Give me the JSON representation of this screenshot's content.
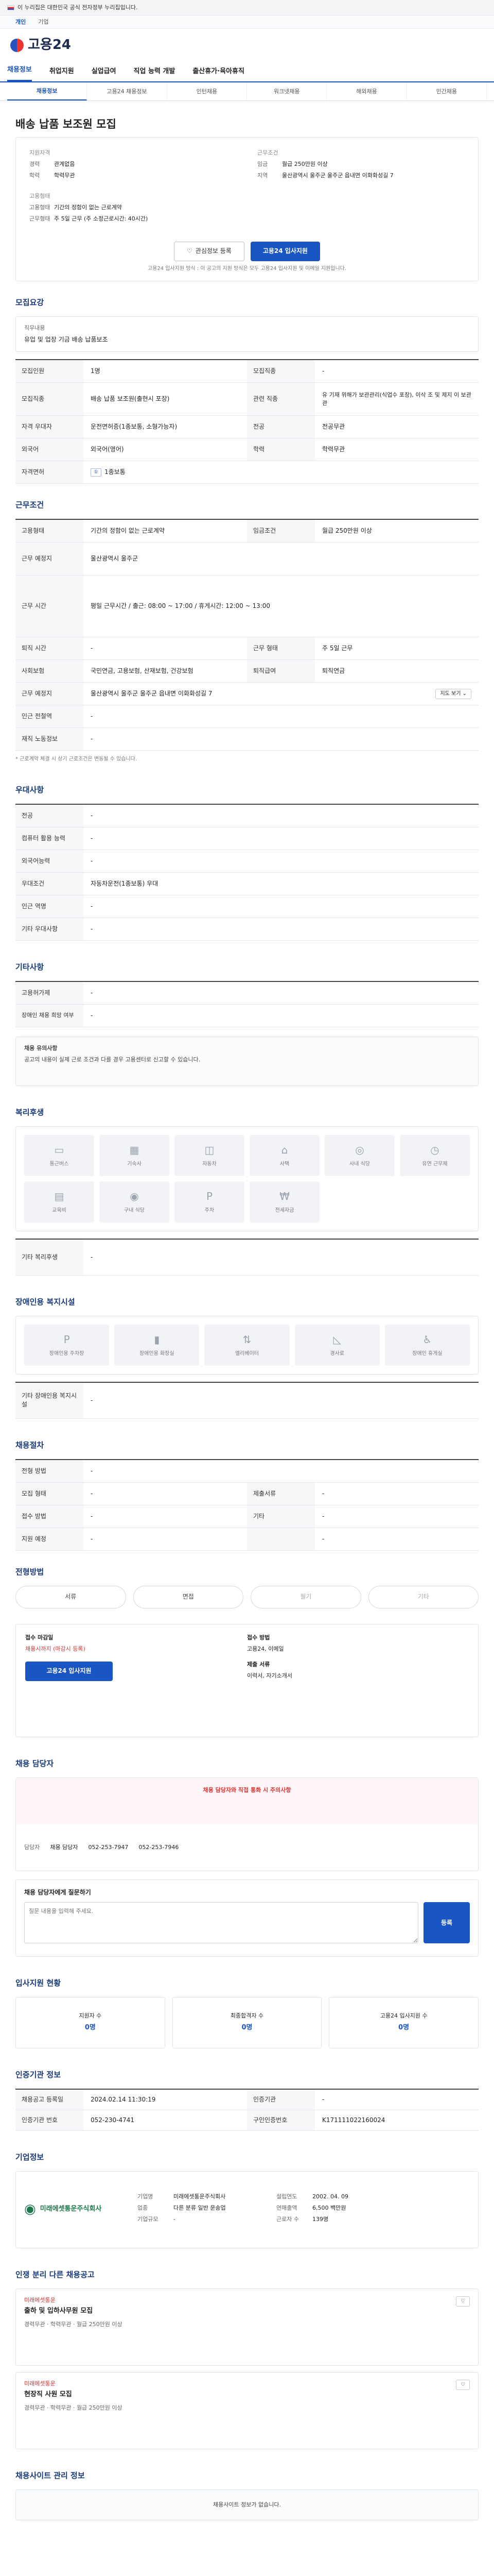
{
  "banner": {
    "text": "이 누리집은 대한민국 공식 전자정부 누리집입니다.",
    "link": ""
  },
  "lang": {
    "items": [
      "개인",
      "기업"
    ]
  },
  "logo": {
    "name": "고용24"
  },
  "gnb": {
    "items": [
      "채용정보",
      "취업지원",
      "실업급여",
      "직업 능력 개발",
      "출산휴가·육아휴직"
    ]
  },
  "subtabs": {
    "items": [
      "채용정보",
      "고용24 채용정보",
      "인턴채용",
      "워크넷채용",
      "해외채용",
      "민간채용"
    ]
  },
  "job": {
    "title": "배송 납품 보조원 모집",
    "summary": {
      "left_head": "지원자격",
      "left": [
        {
          "k": "경력",
          "v": "관계없음"
        },
        {
          "k": "학력",
          "v": "학력무관"
        }
      ],
      "left2_head": "고용형태",
      "left2": [
        {
          "k": "고용형태",
          "v": "기간의 정함이 없는 근로계약"
        },
        {
          "k": "근무형태",
          "v": "주 5일 근무 (주 소정근로시간: 40시간)"
        }
      ],
      "right_head": "근무조건",
      "right": [
        {
          "k": "임금",
          "v": "월급 250만원 이상"
        },
        {
          "k": "지역",
          "v": "울산광역시 울주군 울주군 읍내면 이화화성길 7"
        },
        {
          "k": "",
          "v": ""
        }
      ],
      "btn_save": "관심정보 등록",
      "btn_apply": "고용24 입사지원",
      "note": "고용24 입사지원 방식 : 이 공고의 지원 방식은 모두 고용24 입사지원 및 이메일 지원입니다."
    }
  },
  "sections": {
    "recruit": "모집요강",
    "recruit_job_head": "직무내용",
    "recruit_job": "유업 및 업장 기금 배송 납품보조",
    "recruit_rows": [
      {
        "k": "모집인원",
        "v": "1명",
        "k2": "모집직종",
        "v2": "-"
      },
      {
        "k": "모집직종",
        "v": "배송 납품 보조원(출현시 포장)",
        "k2": "관련 직종",
        "v2": "유 기재 위해가 보관관리(식업수 포장), 이삭 조 및 제지 이 보관관"
      },
      {
        "k": "자격 우대자",
        "v": "운전면허증(1종보통, 소형가능자)",
        "k2": "전공",
        "v2": "전공무관"
      },
      {
        "k": "외국어",
        "v": "외국어(영어)",
        "k2": "학력",
        "v2": "학력무관"
      },
      {
        "k": "자격면허",
        "v": "1종보통",
        "k2": "",
        "v2": ""
      }
    ],
    "work": "근무조건",
    "work_rows": [
      {
        "k": "고용형태",
        "v": "기간의 정함이 없는 근로계약",
        "k2": "임금조건",
        "v2": "월급 250만원 이상"
      },
      {
        "k": "근무 예정지",
        "v": "울산광역시 울주군",
        "k2": "",
        "v2": ""
      },
      {
        "k": "근무 시간",
        "v": "평일 근무시간 / 출근: 08:00 ~ 17:00 / 휴게시간: 12:00 ~ 13:00",
        "k2": "",
        "v2": ""
      },
      {
        "k": "퇴직 시간",
        "v": "-",
        "k2": "근무 형태",
        "v2": "주 5일 근무"
      },
      {
        "k": "사회보험",
        "v": "국민연금, 고용보험, 산재보험, 건강보험",
        "k2": "퇴직급여",
        "v2": "퇴직연금"
      },
      {
        "k": "근무 예정지",
        "v": "울산광역시 울주군 울주군 읍내면 이화화성길 7",
        "k2": "",
        "v2": ""
      },
      {
        "k": "인근 전철역",
        "v": "-",
        "k2": "",
        "v2": ""
      },
      {
        "k": "재직 노동정보",
        "v": "-",
        "k2": "",
        "v2": ""
      }
    ],
    "work_note": "* 근로계약 체결 시 상기 근로조건은 변동될 수 있습니다.",
    "pref": "우대사항",
    "pref_rows": [
      {
        "k": "전공",
        "v": "-"
      },
      {
        "k": "컴퓨터 활용 능력",
        "v": "-"
      },
      {
        "k": "외국어능력",
        "v": "-"
      },
      {
        "k": "우대조건",
        "v": "자동차운전(1종보통) 우대"
      },
      {
        "k": "인근 역명",
        "v": "-"
      },
      {
        "k": "기타 우대사항",
        "v": "-"
      }
    ],
    "etc": "기타사항",
    "etc_rows": [
      {
        "k": "고용허가제",
        "v": "-"
      },
      {
        "k": "장애인 채용 희망 여부",
        "v": "-"
      }
    ],
    "etc_notice_head": "채용 유의사항",
    "etc_notice": "공고의 내용이 실제 근로 조건과 다를 경우 고용센터로 신고할 수 있습니다.",
    "welfare": "복리후생",
    "welfare_items": [
      "통근버스",
      "기숙사",
      "자동차",
      "사택",
      "사내 식당",
      "유연 근무제",
      "교육비",
      "구내 식당",
      "주차",
      "전세자금"
    ],
    "welfare_etc_k": "기타 복리후생",
    "welfare_etc_v": "-",
    "disab": "장애인용 복지시설",
    "disab_items": [
      "장애인용 주차장",
      "장애인용 화장실",
      "엘리베이터",
      "경사로",
      "장애인 휴게실"
    ],
    "disab_etc_k": "기타 장애인용 복지시설",
    "disab_etc_v": "-",
    "process": "채용절차",
    "process_rows": [
      {
        "k": "전형 방법",
        "v": "-",
        "k2": "",
        "v2": ""
      },
      {
        "k": "모집 형태",
        "v": "-",
        "k2": "제출서류",
        "v2": "-"
      },
      {
        "k": "접수 방법",
        "v": "-",
        "k2": "기타",
        "v2": "-"
      },
      {
        "k": "지원 예정",
        "v": "-",
        "k2": "",
        "v2": "-"
      }
    ],
    "steps_title": "전형방법",
    "steps": [
      "서류",
      "면접",
      "필기",
      "기타"
    ],
    "apply_head": "접수 마감일",
    "apply_date": "채용시까지 (마감시 등록)",
    "apply_btn": "고용24 입사지원",
    "apply_method_head": "접수 방법",
    "apply_method": "고용24, 이메일",
    "apply_docs_head": "제출 서류",
    "apply_docs": "이력서, 자기소개서",
    "manager": "채용 담당자",
    "manager_warn": "채용 담당자와 직접 통화 시 주의사항",
    "manager_name_k": "담당자",
    "manager_name_v": "채용 담당자",
    "manager_tel": "052-253-7947",
    "manager_fax": "052-253-7946",
    "inquiry_title": "채용 담당자에게 질문하기",
    "inquiry_placeholder": "질문 내용을 입력해 주세요.",
    "inquiry_btn": "등록",
    "stats": "입사지원 현황",
    "stats_items": [
      {
        "label": "지원자 수",
        "num": "0명"
      },
      {
        "label": "최종합격자 수",
        "num": "0명"
      },
      {
        "label": "고용24 입사지원 수",
        "num": "0명"
      }
    ],
    "info": "인증기관 정보",
    "info_rows": [
      {
        "k": "채용공고 등록일",
        "v": "2024.02.14 11:30:19",
        "k2": "인증기관",
        "v2": "-"
      },
      {
        "k": "인증기관 번호",
        "v": "052-230-4741",
        "k2": "구인인증번호",
        "v2": "K171111022160024"
      }
    ],
    "company": "기업정보",
    "company_name": "미래에셋통운주식회사",
    "company_rows": [
      {
        "k": "기업명",
        "v": "미래에셋통운주식회사",
        "k2": "설립연도",
        "v2": "2002. 04. 09"
      },
      {
        "k": "업종",
        "v": "다른 분류 일반 운송업",
        "k2": "연매출액",
        "v2": "6,500 백만원"
      },
      {
        "k": "기업규모",
        "v": "-",
        "k2": "근로자 수",
        "v2": "139명"
      }
    ],
    "similar": "인쟁 분리 다른 채용공고",
    "similar_items": [
      {
        "company": "미래에셋통운",
        "title": "출하 및 입하사무원 모집",
        "meta": "경력무관 · 학력무관 · 월급 250만원 이상"
      },
      {
        "company": "미래에셋통운",
        "title": "현장직 사원 모집",
        "meta": "경력무관 · 학력무관 · 월급 250만원 이상"
      }
    ],
    "footer_head": "채용사이트 관리 정보",
    "footer_text": "채용사이트 정보가 없습니다."
  }
}
